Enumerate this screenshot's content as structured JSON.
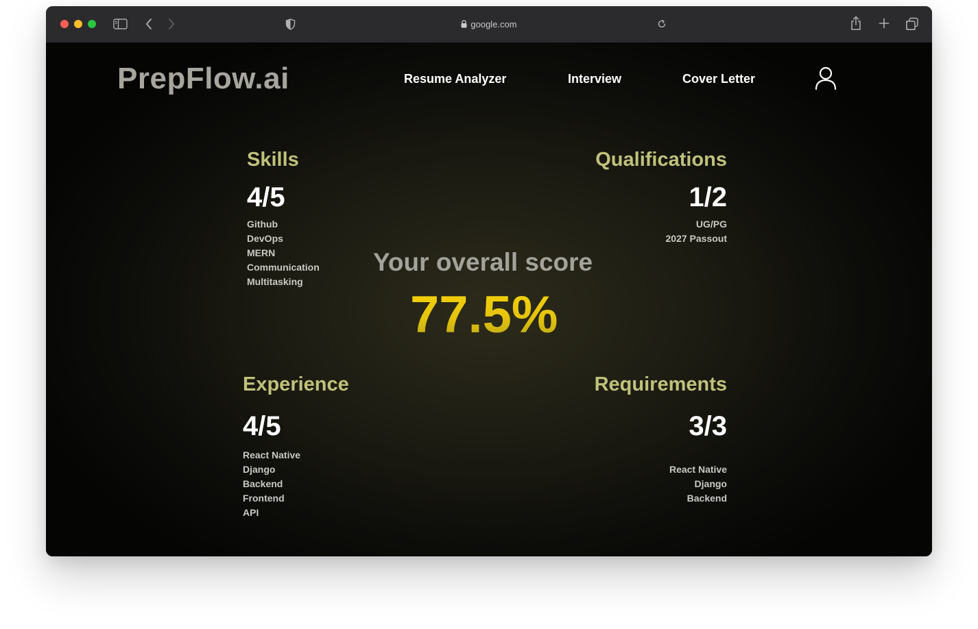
{
  "browser": {
    "url": "google.com"
  },
  "header": {
    "logo": "PrepFlow.ai",
    "nav": [
      {
        "label": "Resume Analyzer"
      },
      {
        "label": "Interview"
      },
      {
        "label": "Cover Letter"
      }
    ]
  },
  "overall": {
    "label": "Your overall score",
    "value": "77.5%"
  },
  "sections": {
    "skills": {
      "title": "Skills",
      "score": "4/5",
      "items": [
        "Github",
        "DevOps",
        "MERN",
        "Communication",
        "Multitasking"
      ]
    },
    "qualifications": {
      "title": "Qualifications",
      "score": "1/2",
      "items": [
        "UG/PG",
        "2027 Passout"
      ]
    },
    "experience": {
      "title": "Experience",
      "score": "4/5",
      "items": [
        "React Native",
        "Django",
        "Backend",
        "Frontend",
        "API"
      ]
    },
    "requirements": {
      "title": "Requirements",
      "score": "3/3",
      "items": [
        "React Native",
        "Django",
        "Backend"
      ]
    }
  },
  "colors": {
    "accent_title": "#bfc27a",
    "score_gold": "#f6d40a",
    "background": "#0d0d0a"
  },
  "icons": {
    "sidebar": "sidebar-icon",
    "back": "chevron-left-icon",
    "forward": "chevron-right-icon",
    "privacy": "shield-icon",
    "lock": "lock-icon",
    "reload": "reload-icon",
    "share": "share-icon",
    "new_tab": "plus-icon",
    "tabs": "tabs-icon",
    "user": "user-icon"
  }
}
